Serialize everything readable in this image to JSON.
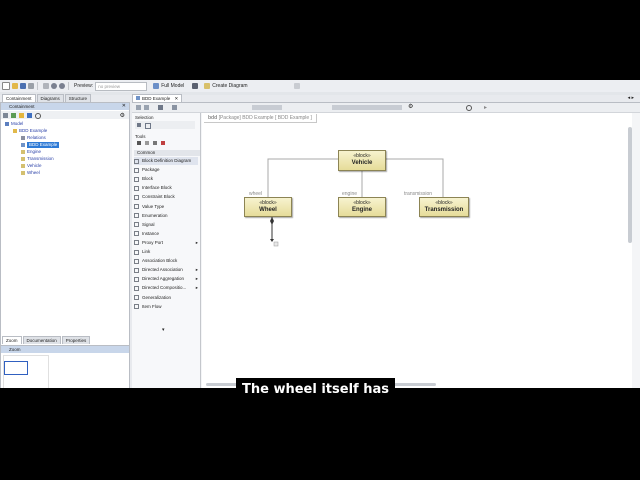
{
  "toolbar": {
    "preview_label": "Preview:",
    "preview_value": "no preview",
    "full_model": "Full Model",
    "create_diagram": "Create Diagram"
  },
  "left_top": {
    "tabs": [
      "Containment",
      "Diagrams",
      "Structure"
    ],
    "header": "Containment",
    "tree": [
      {
        "label": "Model",
        "indent": 0
      },
      {
        "label": "BDD Example",
        "indent": 1
      },
      {
        "label": "Relations",
        "indent": 2
      },
      {
        "label": "BDD Example",
        "indent": 2,
        "selected": true
      },
      {
        "label": "Engine",
        "indent": 2
      },
      {
        "label": "Transmission",
        "indent": 2
      },
      {
        "label": "Vehicle",
        "indent": 2
      },
      {
        "label": "Wheel",
        "indent": 2
      }
    ]
  },
  "left_bottom": {
    "tabs": [
      "Zoom",
      "Documentation",
      "Properties"
    ],
    "header": "Zoom"
  },
  "editor": {
    "tab": "BDD Example",
    "breadcrumb": {
      "kind": "bdd",
      "rest": "[Package] BDD Example [ BDD Example ]"
    }
  },
  "palette": {
    "selection_header": "Selection",
    "tools_header": "Tools",
    "common_group": "Common",
    "items": [
      {
        "label": "Block Definition Diagram",
        "highlight": true
      },
      {
        "label": "Package"
      },
      {
        "label": "Block"
      },
      {
        "label": "Interface Block"
      },
      {
        "label": "Constraint Block"
      },
      {
        "label": "Value Type"
      },
      {
        "label": "Enumeration"
      },
      {
        "label": "Signal"
      },
      {
        "label": "Instance"
      },
      {
        "label": "Proxy Port",
        "more": true
      },
      {
        "label": "Link"
      },
      {
        "label": "Association Block"
      },
      {
        "label": "Directed Association",
        "more": true
      },
      {
        "label": "Directed Aggregation",
        "more": true
      },
      {
        "label": "Directed Compositio...",
        "more": true
      },
      {
        "label": "Generalization"
      },
      {
        "label": "Item Flow"
      }
    ]
  },
  "diagram": {
    "blocks": [
      {
        "id": "vehicle",
        "stereotype": "«block»",
        "name": "Vehicle"
      },
      {
        "id": "wheel",
        "stereotype": "«block»",
        "name": "Wheel"
      },
      {
        "id": "engine",
        "stereotype": "«block»",
        "name": "Engine"
      },
      {
        "id": "transmission",
        "stereotype": "«block»",
        "name": "Transmission"
      }
    ],
    "roles": [
      "wheel",
      "engine",
      "transmission"
    ]
  },
  "caption": "The wheel itself has",
  "colors": {
    "block_fill": "#efe8b6",
    "block_border": "#8c8454",
    "selection": "#2f7bd6",
    "tree_text": "#2a40a8"
  }
}
